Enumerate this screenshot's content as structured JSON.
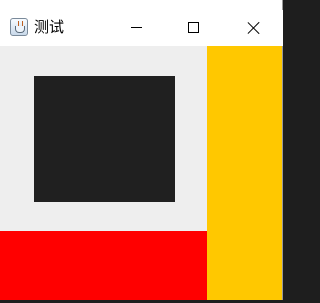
{
  "window": {
    "title": "测试",
    "controls": {
      "minimize": "minimize",
      "maximize": "maximize",
      "close": "close"
    }
  },
  "panels": {
    "dark_color": "#202020",
    "red_color": "#ff0000",
    "yellow_color": "#ffc800",
    "background_color": "#eeeeee"
  },
  "icons": {
    "app": "java-coffee-cup-icon",
    "minimize": "minimize-icon",
    "maximize": "maximize-icon",
    "close": "close-icon"
  }
}
